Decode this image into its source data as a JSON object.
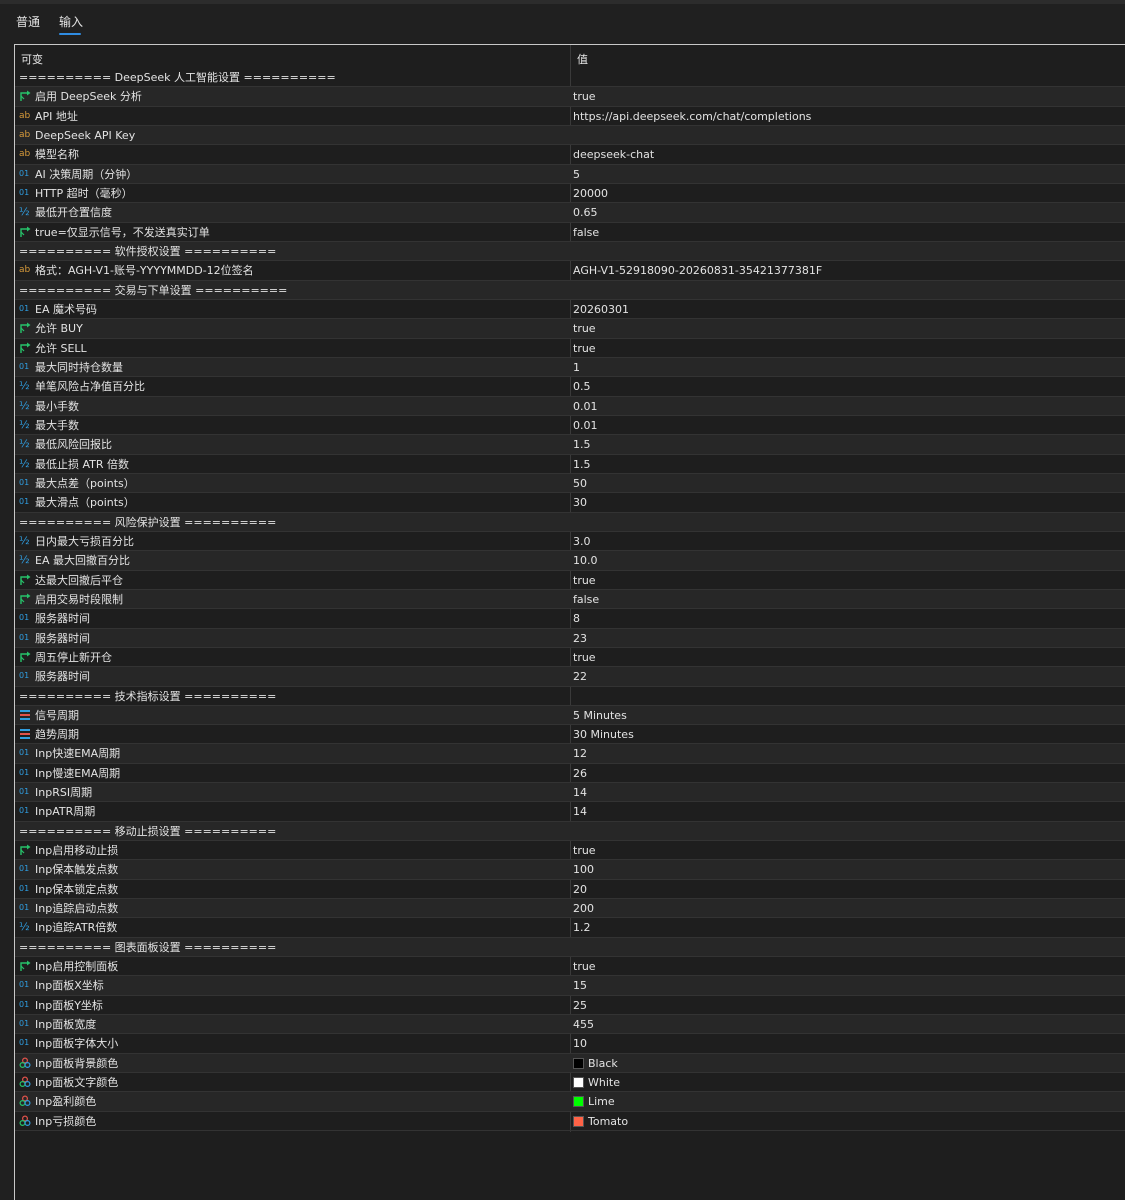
{
  "tabs": [
    {
      "label": "普通",
      "active": false
    },
    {
      "label": "输入",
      "active": true
    }
  ],
  "table": {
    "col_name": "可变",
    "col_value": "值"
  },
  "rows": [
    {
      "type": "section",
      "name": "========== DeepSeek 人工智能设置 ==========",
      "value": ""
    },
    {
      "type": "bool",
      "name": "启用 DeepSeek 分析",
      "value": "true"
    },
    {
      "type": "string",
      "name": "API 地址",
      "value": "https://api.deepseek.com/chat/completions"
    },
    {
      "type": "string",
      "name": "DeepSeek API Key",
      "value": ""
    },
    {
      "type": "string",
      "name": "模型名称",
      "value": "deepseek-chat"
    },
    {
      "type": "int",
      "name": "AI 决策周期（分钟）",
      "value": "5"
    },
    {
      "type": "int",
      "name": "HTTP 超时（毫秒）",
      "value": "20000"
    },
    {
      "type": "double",
      "name": "最低开仓置信度",
      "value": "0.65"
    },
    {
      "type": "bool",
      "name": "true=仅显示信号，不发送真实订单",
      "value": "false"
    },
    {
      "type": "section",
      "name": "========== 软件授权设置 ==========",
      "value": ""
    },
    {
      "type": "string",
      "name": "格式：AGH-V1-账号-YYYYMMDD-12位签名",
      "value": "AGH-V1-52918090-20260831-35421377381F"
    },
    {
      "type": "section",
      "name": "========== 交易与下单设置 ==========",
      "value": ""
    },
    {
      "type": "int",
      "name": "EA 魔术号码",
      "value": "20260301"
    },
    {
      "type": "bool",
      "name": "允许 BUY",
      "value": "true"
    },
    {
      "type": "bool",
      "name": "允许 SELL",
      "value": "true"
    },
    {
      "type": "int",
      "name": "最大同时持仓数量",
      "value": "1"
    },
    {
      "type": "double",
      "name": "单笔风险占净值百分比",
      "value": "0.5"
    },
    {
      "type": "double",
      "name": "最小手数",
      "value": "0.01"
    },
    {
      "type": "double",
      "name": "最大手数",
      "value": "0.01"
    },
    {
      "type": "double",
      "name": "最低风险回报比",
      "value": "1.5"
    },
    {
      "type": "double",
      "name": "最低止损 ATR 倍数",
      "value": "1.5"
    },
    {
      "type": "int",
      "name": "最大点差（points）",
      "value": "50"
    },
    {
      "type": "int",
      "name": "最大滑点（points）",
      "value": "30"
    },
    {
      "type": "section",
      "name": "========== 风险保护设置 ==========",
      "value": ""
    },
    {
      "type": "double",
      "name": "日内最大亏损百分比",
      "value": "3.0"
    },
    {
      "type": "double",
      "name": "EA 最大回撤百分比",
      "value": "10.0"
    },
    {
      "type": "bool",
      "name": "达最大回撤后平仓",
      "value": "true"
    },
    {
      "type": "bool",
      "name": "启用交易时段限制",
      "value": "false"
    },
    {
      "type": "int",
      "name": "服务器时间",
      "value": "8"
    },
    {
      "type": "int",
      "name": "服务器时间",
      "value": "23"
    },
    {
      "type": "bool",
      "name": "周五停止新开仓",
      "value": "true"
    },
    {
      "type": "int",
      "name": "服务器时间",
      "value": "22"
    },
    {
      "type": "section",
      "name": "========== 技术指标设置 ==========",
      "value": ""
    },
    {
      "type": "enum",
      "name": "信号周期",
      "value": "5 Minutes"
    },
    {
      "type": "enum",
      "name": "趋势周期",
      "value": "30 Minutes"
    },
    {
      "type": "int",
      "name": "Inp快速EMA周期",
      "value": "12"
    },
    {
      "type": "int",
      "name": "Inp慢速EMA周期",
      "value": "26"
    },
    {
      "type": "int",
      "name": "InpRSI周期",
      "value": "14"
    },
    {
      "type": "int",
      "name": "InpATR周期",
      "value": "14"
    },
    {
      "type": "section",
      "name": "========== 移动止损设置 ==========",
      "value": ""
    },
    {
      "type": "bool",
      "name": "Inp启用移动止损",
      "value": "true"
    },
    {
      "type": "int",
      "name": "Inp保本触发点数",
      "value": "100"
    },
    {
      "type": "int",
      "name": "Inp保本锁定点数",
      "value": "20"
    },
    {
      "type": "int",
      "name": "Inp追踪启动点数",
      "value": "200"
    },
    {
      "type": "double",
      "name": "Inp追踪ATR倍数",
      "value": "1.2"
    },
    {
      "type": "section",
      "name": "========== 图表面板设置 ==========",
      "value": ""
    },
    {
      "type": "bool",
      "name": "Inp启用控制面板",
      "value": "true"
    },
    {
      "type": "int",
      "name": "Inp面板X坐标",
      "value": "15"
    },
    {
      "type": "int",
      "name": "Inp面板Y坐标",
      "value": "25"
    },
    {
      "type": "int",
      "name": "Inp面板宽度",
      "value": "455"
    },
    {
      "type": "int",
      "name": "Inp面板字体大小",
      "value": "10"
    },
    {
      "type": "color",
      "name": "Inp面板背景颜色",
      "value": "Black",
      "swatch": "#000000"
    },
    {
      "type": "color",
      "name": "Inp面板文字颜色",
      "value": "White",
      "swatch": "#ffffff"
    },
    {
      "type": "color",
      "name": "Inp盈利颜色",
      "value": "Lime",
      "swatch": "#00ff00"
    },
    {
      "type": "color",
      "name": "Inp亏损颜色",
      "value": "Tomato",
      "swatch": "#ff6347"
    }
  ],
  "icons": {
    "bool": "bool-arrow-icon",
    "string": "string-ab-icon",
    "int": "int-01-icon",
    "double": "double-half-icon",
    "enum": "enum-list-icon",
    "color": "color-palette-icon"
  },
  "colors": {
    "accent": "#2f8ce2",
    "bool_icon": "#27c26a",
    "string_icon": "#d79a3a",
    "number_icon": "#2f9de0"
  }
}
